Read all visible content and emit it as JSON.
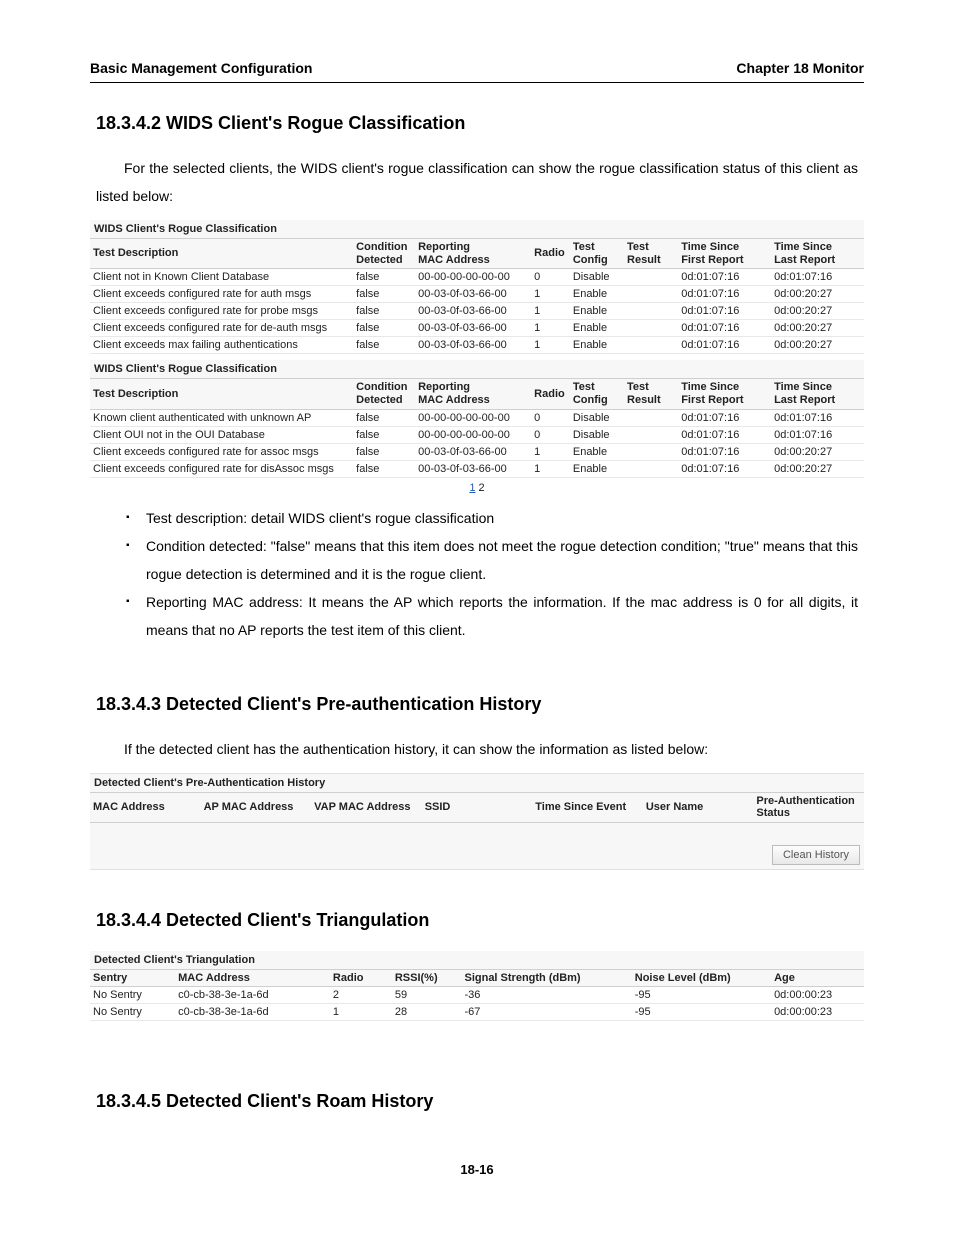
{
  "header": {
    "left": "Basic Management Configuration",
    "right": "Chapter 18 Monitor"
  },
  "sec1": {
    "title": "18.3.4.2 WIDS Client's Rogue Classification",
    "para": "For the selected clients, the WIDS client's rogue classification can show the rogue classification status of this client as listed below:"
  },
  "rogue_headers": {
    "c0": "Test Description",
    "c1a": "Condition",
    "c1b": "Detected",
    "c2a": "Reporting",
    "c2b": "MAC Address",
    "c3": "Radio",
    "c4a": "Test",
    "c4b": "Config",
    "c5a": "Test",
    "c5b": "Result",
    "c6a": "Time Since",
    "c6b": "First Report",
    "c7a": "Time Since",
    "c7b": "Last Report"
  },
  "rogue1_title": "WIDS Client's Rogue Classification",
  "rogue1_rows": [
    {
      "desc": "Client not in Known Client Database",
      "cond": "false",
      "mac": "00-00-00-00-00-00",
      "radio": "0",
      "cfg": "Disable",
      "res": "",
      "t1": "0d:01:07:16",
      "t2": "0d:01:07:16"
    },
    {
      "desc": "Client exceeds configured rate for auth msgs",
      "cond": "false",
      "mac": "00-03-0f-03-66-00",
      "radio": "1",
      "cfg": "Enable",
      "res": "",
      "t1": "0d:01:07:16",
      "t2": "0d:00:20:27"
    },
    {
      "desc": "Client exceeds configured rate for probe msgs",
      "cond": "false",
      "mac": "00-03-0f-03-66-00",
      "radio": "1",
      "cfg": "Enable",
      "res": "",
      "t1": "0d:01:07:16",
      "t2": "0d:00:20:27"
    },
    {
      "desc": "Client exceeds configured rate for de-auth msgs",
      "cond": "false",
      "mac": "00-03-0f-03-66-00",
      "radio": "1",
      "cfg": "Enable",
      "res": "",
      "t1": "0d:01:07:16",
      "t2": "0d:00:20:27"
    },
    {
      "desc": "Client exceeds max failing authentications",
      "cond": "false",
      "mac": "00-03-0f-03-66-00",
      "radio": "1",
      "cfg": "Enable",
      "res": "",
      "t1": "0d:01:07:16",
      "t2": "0d:00:20:27"
    }
  ],
  "rogue2_title": "WIDS Client's Rogue Classification",
  "rogue2_rows": [
    {
      "desc": "Known client authenticated with unknown AP",
      "cond": "false",
      "mac": "00-00-00-00-00-00",
      "radio": "0",
      "cfg": "Disable",
      "res": "",
      "t1": "0d:01:07:16",
      "t2": "0d:01:07:16"
    },
    {
      "desc": "Client OUI not in the OUI Database",
      "cond": "false",
      "mac": "00-00-00-00-00-00",
      "radio": "0",
      "cfg": "Disable",
      "res": "",
      "t1": "0d:01:07:16",
      "t2": "0d:01:07:16"
    },
    {
      "desc": "Client exceeds configured rate for assoc msgs",
      "cond": "false",
      "mac": "00-03-0f-03-66-00",
      "radio": "1",
      "cfg": "Enable",
      "res": "",
      "t1": "0d:01:07:16",
      "t2": "0d:00:20:27"
    },
    {
      "desc": "Client exceeds configured rate for disAssoc msgs",
      "cond": "false",
      "mac": "00-03-0f-03-66-00",
      "radio": "1",
      "cfg": "Enable",
      "res": "",
      "t1": "0d:01:07:16",
      "t2": "0d:00:20:27"
    }
  ],
  "pager": {
    "p1": "1",
    "p2": "2"
  },
  "bullets": [
    "Test description: detail WIDS client's rogue classification",
    "Condition detected: \"false\" means that this item does not meet the rogue detection condition; \"true\" means that this rogue detection is determined and it is the rogue client.",
    "Reporting MAC address: It means the AP which reports the information. If the mac address is 0 for all digits, it means that no AP reports the test item of this client."
  ],
  "sec2": {
    "title": "18.3.4.3 Detected Client's Pre-authentication History",
    "para": "If the detected client has the authentication history, it can show the information as listed below:"
  },
  "auth_panel_title": "Detected Client's Pre-Authentication History",
  "auth_headers": {
    "c0": "MAC Address",
    "c1": "AP MAC Address",
    "c2": "VAP MAC Address",
    "c3": "SSID",
    "c4": "Time Since Event",
    "c5": "User Name",
    "c6": "Pre-Authentication Status"
  },
  "btn_clean": "Clean History",
  "sec3": {
    "title": "18.3.4.4 Detected Client's Triangulation"
  },
  "tri_panel_title": "Detected Client's Triangulation",
  "tri_headers": {
    "c0": "Sentry",
    "c1": "MAC Address",
    "c2": "Radio",
    "c3": "RSSI(%)",
    "c4": "Signal Strength (dBm)",
    "c5": "Noise Level (dBm)",
    "c6": "Age"
  },
  "tri_rows": [
    {
      "sentry": "No Sentry",
      "mac": "c0-cb-38-3e-1a-6d",
      "radio": "2",
      "rssi": "59",
      "sig": "-36",
      "noise": "-95",
      "age": "0d:00:00:23"
    },
    {
      "sentry": "No Sentry",
      "mac": "c0-cb-38-3e-1a-6d",
      "radio": "1",
      "rssi": "28",
      "sig": "-67",
      "noise": "-95",
      "age": "0d:00:00:23"
    }
  ],
  "sec4": {
    "title": "18.3.4.5 Detected Client's Roam History"
  },
  "pagenum": "18-16"
}
